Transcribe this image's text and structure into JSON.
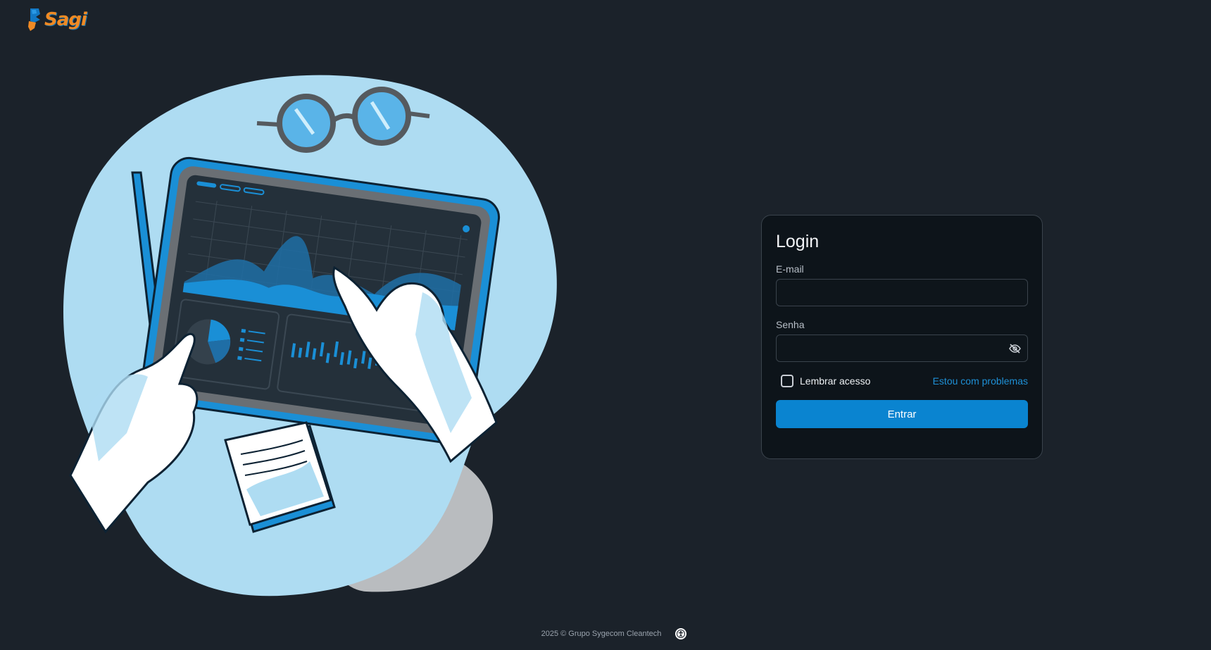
{
  "brand": {
    "name": "Sagi",
    "logo_icon": "sagi-logo-icon",
    "primary_color": "#0a84d0",
    "accent_color": "#f08a24"
  },
  "login": {
    "title": "Login",
    "email_label": "E-mail",
    "email_value": "",
    "password_label": "Senha",
    "password_value": "",
    "toggle_visibility_icon": "eye-off-icon",
    "remember_label": "Lembrar acesso",
    "remember_checked": false,
    "problems_link": "Estou com problemas",
    "submit_label": "Entrar"
  },
  "footer": {
    "copyright": "2025 © Grupo Sygecom Cleantech",
    "accessibility_icon": "accessibility-icon"
  }
}
